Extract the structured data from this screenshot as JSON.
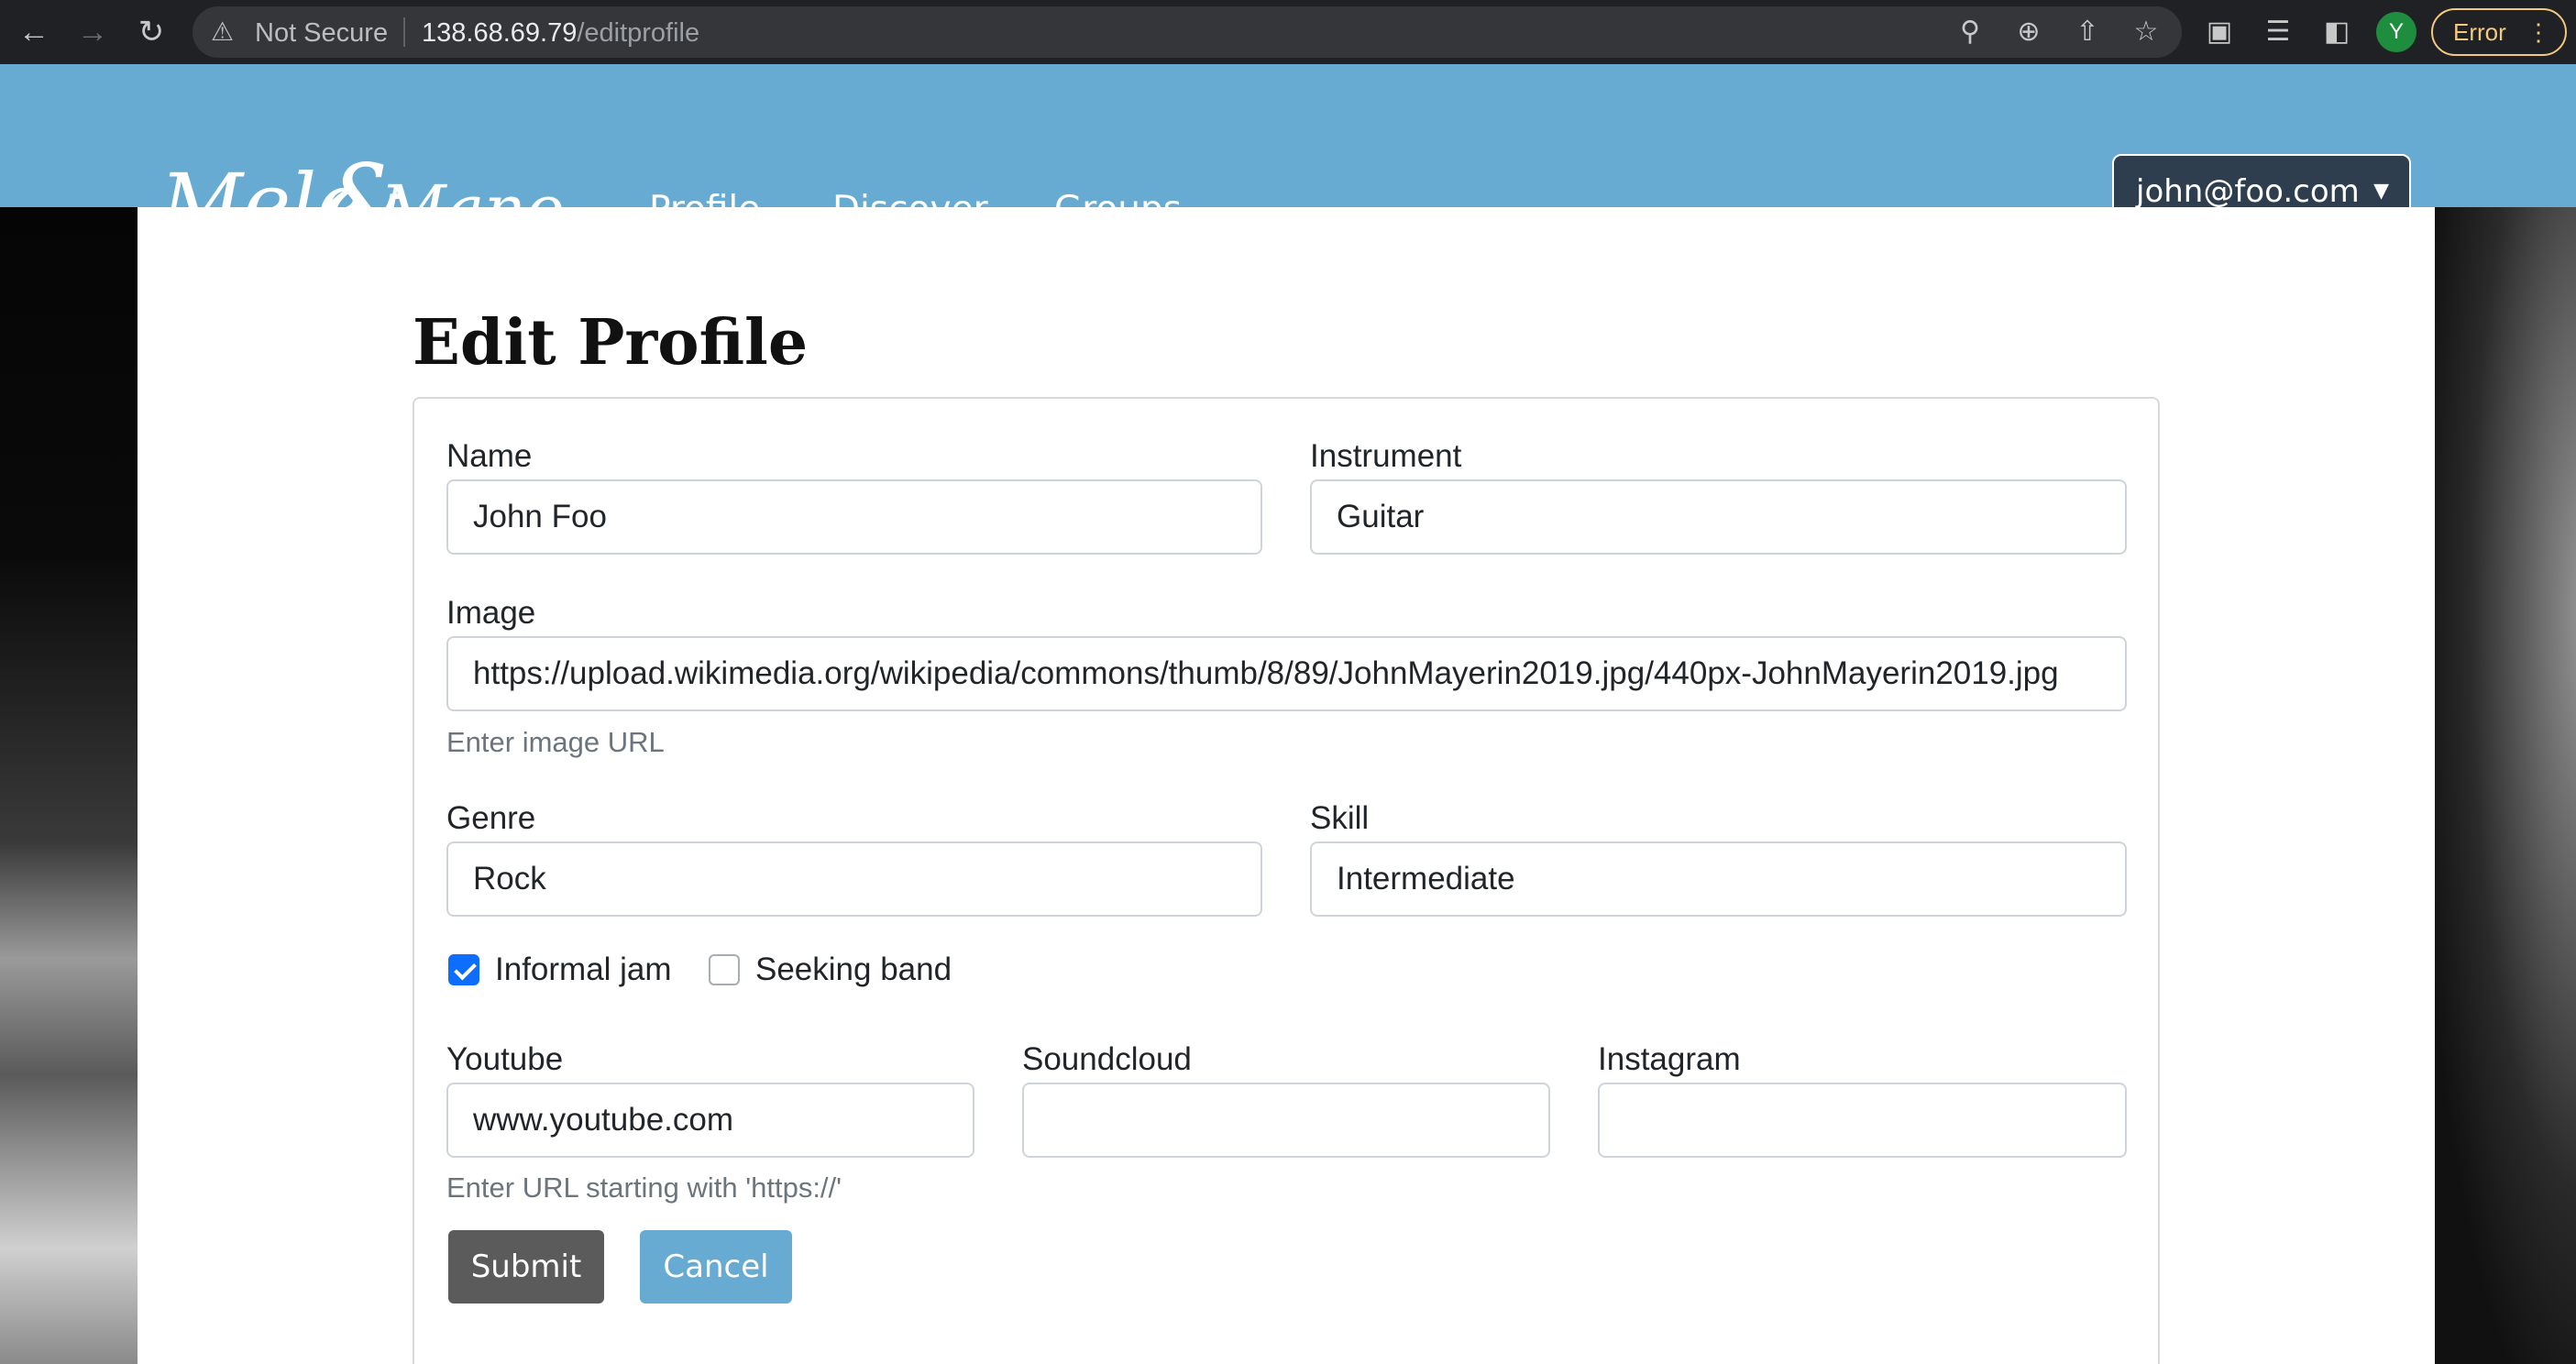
{
  "browser": {
    "security_label": "Not Secure",
    "url_host": "138.68.69.79",
    "url_path": "/editprofile",
    "profile_initial": "Y",
    "error_label": "Error"
  },
  "nav": {
    "logo_text": "Mele & Manoa",
    "links": [
      "Profile",
      "Discover",
      "Groups"
    ],
    "user": "john@foo.com"
  },
  "page": {
    "title": "Edit Profile"
  },
  "form": {
    "name": {
      "label": "Name",
      "value": "John Foo"
    },
    "instrument": {
      "label": "Instrument",
      "value": "Guitar"
    },
    "image": {
      "label": "Image",
      "value": "https://upload.wikimedia.org/wikipedia/commons/thumb/8/89/JohnMayerin2019.jpg/440px-JohnMayerin2019.jpg",
      "help": "Enter image URL"
    },
    "genre": {
      "label": "Genre",
      "value": "Rock"
    },
    "skill": {
      "label": "Skill",
      "value": "Intermediate"
    },
    "informal_jam": {
      "label": "Informal jam",
      "checked": true
    },
    "seeking_band": {
      "label": "Seeking band",
      "checked": false
    },
    "youtube": {
      "label": "Youtube",
      "value": "www.youtube.com",
      "help": "Enter URL starting with 'https://'"
    },
    "soundcloud": {
      "label": "Soundcloud",
      "value": ""
    },
    "instagram": {
      "label": "Instagram",
      "value": ""
    },
    "submit_label": "Submit",
    "cancel_label": "Cancel"
  },
  "colors": {
    "navbar": "#67abd2",
    "submit": "#5b5b5b",
    "cancel": "#67abd2",
    "checkbox": "#0d6efd"
  }
}
